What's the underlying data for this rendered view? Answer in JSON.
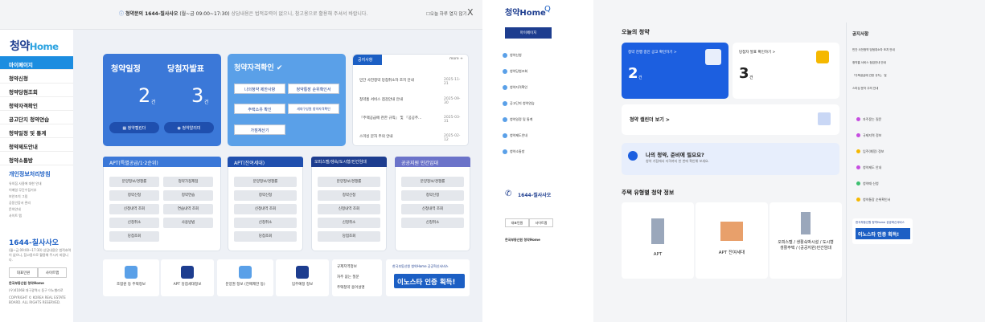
{
  "topbar": {
    "title": "청약문의 1644-칠사사오",
    "hours": "(월~금 09:00~17:30)",
    "notice": "상담내용은 법적효력이 없으니, 참고용으로 활용해 주셔서 바랍니다.",
    "today_hide": "☐오늘 하루 열지 않기",
    "close": "X"
  },
  "logo": {
    "main": "청약",
    "sub": "Home"
  },
  "sidebar": {
    "items": [
      "마이페이지",
      "청약신청",
      "청약당첨조회",
      "청약자격확인",
      "공고단지 청약연습",
      "청약일정 및 통계",
      "청약제도안내",
      "청약소통방"
    ],
    "privacy": "개인정보처리방침",
    "small": [
      "유의집 사용에 대한 안내",
      "이메일 무단수집거부",
      "보안조치 그림",
      "공동인증서 관리",
      "문의안내",
      "사이트 맵"
    ],
    "tel": "1644-칠사사오",
    "tel_desc": "(월~금 09:00~17:30) 상담내용은 법적효력이 없으니, 참고용으로 활용해 주시기 바랍니다.",
    "btn_a": "대표민원",
    "btn_b": "사이트맵",
    "org": "한국부동산원 청약Home",
    "addr": "(우)41068 대구광역시 동구 이노밸리로",
    "copy": "COPYRIGHT © KOREA REAL ESTATE BOARD. ALL RIGHTS RESERVED."
  },
  "sched": {
    "title1": "청약일정",
    "title2": "당첨자발표",
    "count1": "2",
    "count2": "3",
    "unit": "건",
    "btn1": "청약캘린더",
    "btn2": "청약알리미"
  },
  "qual": {
    "title": "청약자격확인",
    "btns": [
      "나의청약 제한사항",
      "청약통장 순위확인서",
      "주택소유 확인",
      "세대구성원 청약자격확인",
      "가점계산기"
    ]
  },
  "notice": {
    "tab": "공지사항",
    "more": "more +",
    "rows": [
      {
        "t": "민간 사전청약 당첨취소자 조치 안내",
        "d": "2025-11-21"
      },
      {
        "t": "청약홈 서비스 점검안내 안내",
        "d": "2025-09-30"
      },
      {
        "t": "『주택공급에 관한 규칙』 및 『공공주…",
        "d": "2025-03-31"
      },
      {
        "t": "스미싱 문자 주의 안내",
        "d": "2025-02-12"
      }
    ]
  },
  "cats": [
    {
      "title": "APT(특별공급/1·2순위)",
      "btns": [
        "분양정보/경쟁률",
        "청약가점제점",
        "청약신청",
        "청약연습",
        "신청내역 조회",
        "연습내역 조회",
        "신청취소",
        "사용방법",
        "당첨조회"
      ]
    },
    {
      "title": "APT(잔여세대)",
      "btns": [
        "분양정보/경쟁률",
        "청약신청",
        "신청내역 조회",
        "신청취소",
        "당첨조회"
      ]
    },
    {
      "title": "오피스텔/생숙/도시형/민간임대",
      "btns": [
        "분양정보/경쟁률",
        "청약신청",
        "신청내역 조회",
        "신청취소",
        "당첨조회"
      ]
    },
    {
      "title": "공공지원 민간임대",
      "btns": [
        "분양정보/경쟁률",
        "청약신청",
        "신청내역 조회",
        "신청취소"
      ]
    }
  ],
  "quick": [
    "조합원 등 주택정보",
    "APT 당첨세대정보",
    "분양권 정보 (전매제한 등)",
    "입주예정 정보"
  ],
  "links": [
    "규제지역정보",
    "자주 묻는 질문",
    "주택청약 용어설명"
  ],
  "banner": {
    "top": "한국부동산원 청약Home 공공혁신서비스",
    "main": "이노스타 인증 획득!"
  },
  "mobile": {
    "logo": "청약Home",
    "search": "Q",
    "my": "마이페이지",
    "menu": [
      "청약신청",
      "청약당첨조회",
      "청약자격확인",
      "공고단지 청약연습",
      "청약일정 및 통계",
      "청약제도안내",
      "청약소통방"
    ],
    "tel": "1644-칠사사오",
    "btn_a": "대표민원",
    "btn_b": "사이트맵",
    "org": "한국부동산원 청약Home"
  },
  "p3": {
    "today": "오늘의 청약",
    "c1": "청약 진행 중인 공고 확인하기 >",
    "c1n": "2",
    "c2": "당첨자 발표 확인하기 >",
    "c2n": "3",
    "unit": "건",
    "cal": "청약 캘린더 보기 >",
    "ready": "나의 청약, 준비에 필요요?",
    "ready_sub": "청약 가점에서 자격까지 한 번에 확인해 보세요.",
    "types_title": "주택 유형별 청약 정보",
    "types": [
      "APT",
      "APT 잔여세대",
      "오피스텔 / 생활숙박시설 / 도시형생활주택 / (공공지원)민간임대"
    ],
    "nt": "공지사항",
    "nrows": [
      "민간 사전청약 당첨취소자 조치 안내",
      "청약홈 서비스 점검안내 안내",
      "『주택공급에 관한 규칙』 및",
      "스미싱 문자 주의 안내"
    ],
    "right": [
      "자주묻는 질문",
      "규제지역 정보",
      "입주(예정) 정보",
      "청약제도 안내",
      "청약때 신청",
      "청약통장 순위확인서"
    ]
  },
  "colors": {
    "accent": "#1c8de0",
    "primary": "#3b78d8",
    "dark": "#1d3d8f"
  }
}
